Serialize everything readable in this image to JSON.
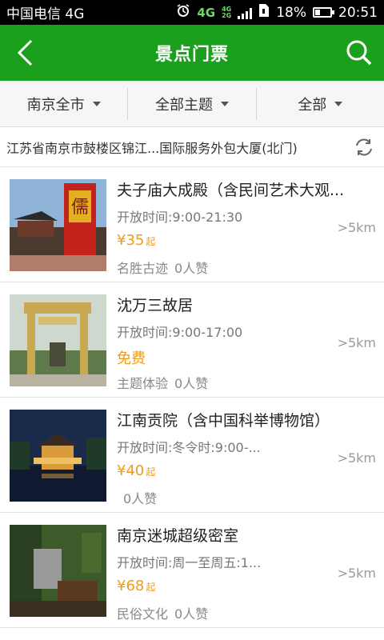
{
  "status": {
    "carrier": "中国电信 4G",
    "net_main": "4G",
    "net_top": "4G",
    "net_bottom": "2G",
    "battery": "18%",
    "time": "20:51"
  },
  "header": {
    "title": "景点门票"
  },
  "filters": [
    {
      "label": "南京全市"
    },
    {
      "label": "全部主题"
    },
    {
      "label": "全部"
    }
  ],
  "location": {
    "text": "江苏省南京市鼓楼区锦江...国际服务外包大厦(北门)"
  },
  "items": [
    {
      "name": "夫子庙大成殿（含民间艺术大观...",
      "hours": "开放时间:9:00-21:30",
      "price": "¥35",
      "price_suffix": "起",
      "category": "名胜古迹",
      "likes": "0人赞",
      "distance": ">5km"
    },
    {
      "name": "沈万三故居",
      "hours": "开放时间:9:00-17:00",
      "price": "免费",
      "price_suffix": "",
      "category": "主题体验",
      "likes": "0人赞",
      "distance": ">5km"
    },
    {
      "name": "江南贡院（含中国科举博物馆）",
      "hours": "开放时间:冬令时:9:00-...",
      "price": "¥40",
      "price_suffix": "起",
      "category": "",
      "likes": "0人赞",
      "distance": ">5km"
    },
    {
      "name": "南京迷城超级密室",
      "hours": "开放时间:周一至周五:1...",
      "price": "¥68",
      "price_suffix": "起",
      "category": "民俗文化",
      "likes": "0人赞",
      "distance": ">5km"
    }
  ],
  "colors": {
    "brand": "#1ba01e",
    "price": "#f19b17"
  }
}
